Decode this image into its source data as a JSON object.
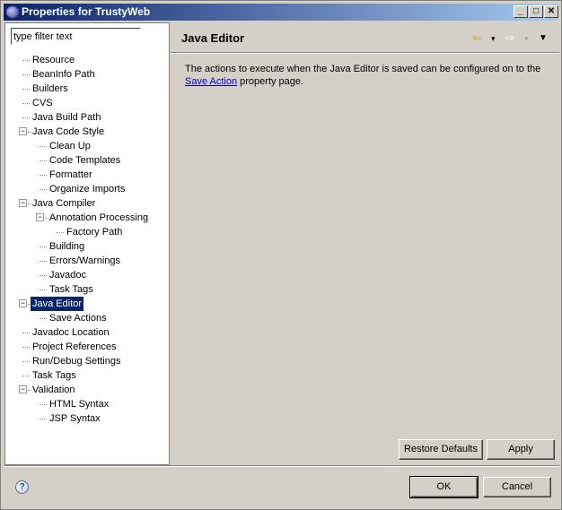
{
  "window": {
    "title": "Properties for TrustyWeb",
    "minimize": "_",
    "maximize": "□",
    "close": "✕"
  },
  "filter": {
    "placeholder": "type filter text",
    "value": "type filter text"
  },
  "tree": [
    {
      "label": "Resource",
      "level": 0,
      "expandable": false
    },
    {
      "label": "BeanInfo Path",
      "level": 0,
      "expandable": false
    },
    {
      "label": "Builders",
      "level": 0,
      "expandable": false
    },
    {
      "label": "CVS",
      "level": 0,
      "expandable": false
    },
    {
      "label": "Java Build Path",
      "level": 0,
      "expandable": false
    },
    {
      "label": "Java Code Style",
      "level": 0,
      "expandable": true
    },
    {
      "label": "Clean Up",
      "level": 1,
      "expandable": false
    },
    {
      "label": "Code Templates",
      "level": 1,
      "expandable": false
    },
    {
      "label": "Formatter",
      "level": 1,
      "expandable": false
    },
    {
      "label": "Organize Imports",
      "level": 1,
      "expandable": false
    },
    {
      "label": "Java Compiler",
      "level": 0,
      "expandable": true
    },
    {
      "label": "Annotation Processing",
      "level": 1,
      "expandable": true
    },
    {
      "label": "Factory Path",
      "level": 2,
      "expandable": false
    },
    {
      "label": "Building",
      "level": 1,
      "expandable": false
    },
    {
      "label": "Errors/Warnings",
      "level": 1,
      "expandable": false
    },
    {
      "label": "Javadoc",
      "level": 1,
      "expandable": false
    },
    {
      "label": "Task Tags",
      "level": 1,
      "expandable": false
    },
    {
      "label": "Java Editor",
      "level": 0,
      "expandable": true,
      "selected": true
    },
    {
      "label": "Save Actions",
      "level": 1,
      "expandable": false
    },
    {
      "label": "Javadoc Location",
      "level": 0,
      "expandable": false
    },
    {
      "label": "Project References",
      "level": 0,
      "expandable": false
    },
    {
      "label": "Run/Debug Settings",
      "level": 0,
      "expandable": false
    },
    {
      "label": "Task Tags",
      "level": 0,
      "expandable": false
    },
    {
      "label": "Validation",
      "level": 0,
      "expandable": true
    },
    {
      "label": "HTML Syntax",
      "level": 1,
      "expandable": false
    },
    {
      "label": "JSP Syntax",
      "level": 1,
      "expandable": false
    }
  ],
  "page": {
    "title": "Java Editor",
    "description_before": "The actions to execute when the Java Editor is saved can be configured on to the ",
    "link": "Save Action",
    "description_after": " property page."
  },
  "buttons": {
    "restore_defaults": "Restore Defaults",
    "apply": "Apply",
    "ok": "OK",
    "cancel": "Cancel",
    "help": "?"
  },
  "nav": {
    "back": "⇦",
    "forward": "⇨",
    "dropdown": "▾",
    "menu": "▼"
  }
}
